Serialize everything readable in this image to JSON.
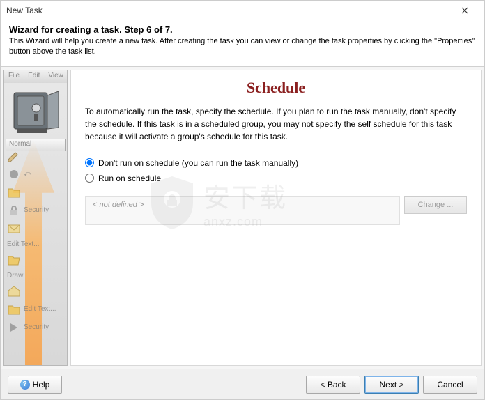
{
  "titlebar": {
    "text": "New Task"
  },
  "header": {
    "title": "Wizard for creating a task. Step 6 of 7.",
    "desc": "This Wizard will help you create a new task. After creating the task you can view or change the task properties by clicking the \"Properties\" button above the task list."
  },
  "sidebar": {
    "menu": [
      "File",
      "Edit",
      "View"
    ],
    "normal": "Normal",
    "items": [
      {
        "label": ""
      },
      {
        "label": "Security"
      },
      {
        "label": ""
      },
      {
        "label": "Edit Text..."
      },
      {
        "label": ""
      },
      {
        "label": "Draw"
      },
      {
        "label": "Edit Text..."
      },
      {
        "label": "Security"
      }
    ]
  },
  "content": {
    "title": "Schedule",
    "desc": "To automatically run the task, specify the schedule. If you plan to run the task manually, don't specify the schedule. If this task is in a scheduled group, you may not specify the self schedule for this task because it will activate a group's schedule for this task.",
    "radio": {
      "dont_run": "Don't run on schedule (you can run the task manually)",
      "run": "Run on schedule",
      "selected": "dont_run"
    },
    "schedule_text": "< not defined >",
    "change_btn": "Change ..."
  },
  "watermark": {
    "text": "安下载",
    "sub": "anxz.com"
  },
  "footer": {
    "help": "Help",
    "back": "< Back",
    "next": "Next >",
    "cancel": "Cancel"
  }
}
